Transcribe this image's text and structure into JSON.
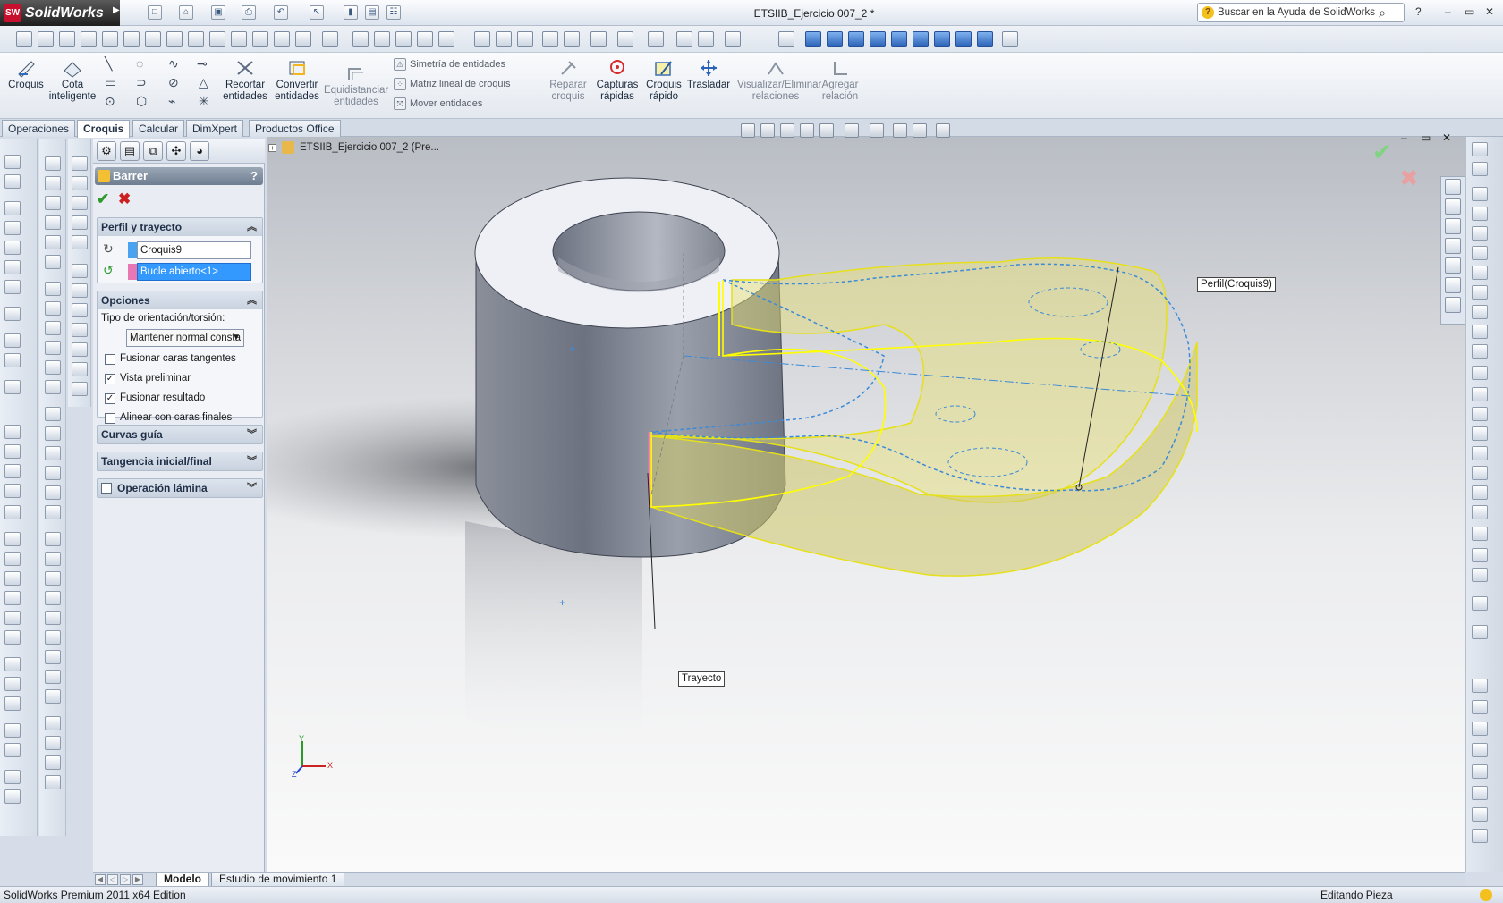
{
  "app": {
    "logo_text": "SolidWorks",
    "logo_badge": "SW",
    "document_title": "ETSIIB_Ejercicio 007_2 *",
    "help_search_placeholder": "Buscar en la Ayuda de SolidWorks",
    "window_controls": [
      "?",
      "–",
      "▭",
      "✕"
    ]
  },
  "command_manager": {
    "buttons": [
      {
        "label": "Croquis",
        "icon": "sketch-icon"
      },
      {
        "label": "Cota\ninteligente",
        "icon": "smart-dimension-icon"
      },
      {
        "label": "Recortar\nentidades",
        "icon": "trim-icon"
      },
      {
        "label": "Convertir\nentidades",
        "icon": "convert-icon"
      },
      {
        "label": "Equidistanciar\nentidades",
        "icon": "offset-icon",
        "disabled": true
      },
      {
        "label": "Reparar\ncroquis",
        "icon": "repair-sketch-icon",
        "disabled": true
      },
      {
        "label": "Capturas\nrápidas",
        "icon": "quick-snaps-icon"
      },
      {
        "label": "Croquis\nrápido",
        "icon": "rapid-sketch-icon"
      },
      {
        "label": "Trasladar",
        "icon": "move-icon"
      },
      {
        "label": "Visualizar/Eliminar\nrelaciones",
        "icon": "display-relations-icon",
        "disabled": true
      },
      {
        "label": "Agregar\nrelación",
        "icon": "add-relation-icon",
        "disabled": true
      }
    ],
    "small_items": [
      {
        "label": "Simetría de entidades",
        "icon": "mirror-icon"
      },
      {
        "label": "Matriz lineal de croquis",
        "icon": "linear-pattern-icon"
      },
      {
        "label": "Mover entidades",
        "icon": "move-entities-icon"
      }
    ]
  },
  "tabs": [
    "Operaciones",
    "Croquis",
    "Calcular",
    "DimXpert",
    "Productos Office"
  ],
  "active_tab": "Croquis",
  "property_manager": {
    "title": "Barrer",
    "help": "?",
    "ok_symbol": "✔",
    "cancel_symbol": "✖",
    "groups": {
      "profile_path": {
        "title": "Perfil y trayecto",
        "profile_value": "Croquis9",
        "profile_color": "#4aa3f0",
        "path_value": "Bucle abierto<1>",
        "path_color": "#e878b4"
      },
      "options": {
        "title": "Opciones",
        "orientation_label": "Tipo de orientación/torsión:",
        "orientation_value": "Mantener normal consta",
        "checkboxes": [
          {
            "label": "Fusionar caras tangentes",
            "checked": false
          },
          {
            "label": "Vista preliminar",
            "checked": true
          },
          {
            "label": "Fusionar resultado",
            "checked": true
          },
          {
            "label": "Alinear con caras finales",
            "checked": false
          }
        ]
      },
      "collapsed": [
        "Curvas guía",
        "Tangencia inicial/final",
        "Operación lámina"
      ]
    }
  },
  "viewport": {
    "tree_label": "ETSIIB_Ejercicio 007_2  (Pre...",
    "callout_profile": "Perfil(Croquis9)",
    "callout_path": "Trayecto",
    "triad_axes": [
      "Y",
      "X",
      "Z"
    ],
    "preview_color": "#e8e170",
    "sketch_color": "#ffff00",
    "axis_color": "#3c8ad8"
  },
  "bottom_tabs": [
    "Modelo",
    "Estudio de movimiento 1"
  ],
  "active_bottom_tab": "Modelo",
  "status": {
    "left": "SolidWorks Premium 2011 x64 Edition",
    "right": "Editando Pieza"
  }
}
